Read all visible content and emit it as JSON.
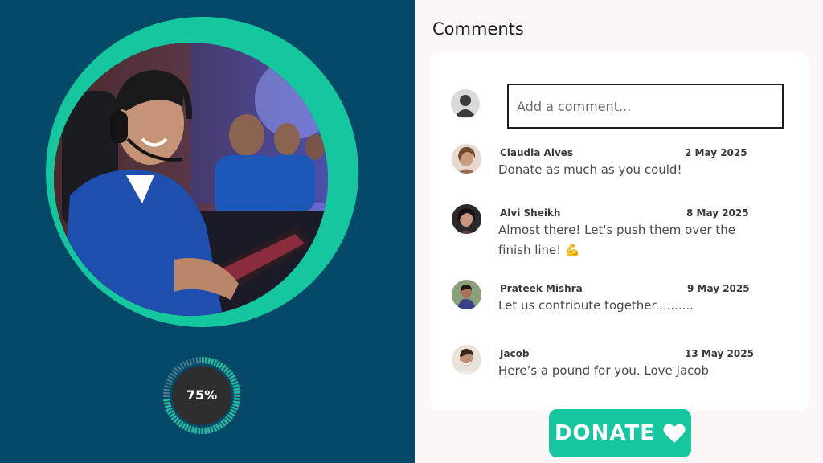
{
  "colors": {
    "left_bg": "#044a68",
    "accent": "#14c79e",
    "right_bg": "#fdf6f6",
    "progress_track": "#d9d9d9",
    "progress_center": "#2e2e2e"
  },
  "campaign": {
    "image_icon": "gamer-photo",
    "progress": {
      "percent": 75,
      "label": "75%"
    }
  },
  "comments_section": {
    "title": "Comments",
    "input": {
      "placeholder": "Add a comment...",
      "value": ""
    },
    "user_avatar_icon": "user-avatar-icon",
    "comments": [
      {
        "name": "Claudia Alves",
        "date": "2 May 2025",
        "text": "Donate as much as you could!"
      },
      {
        "name": "Alvi Sheikh",
        "date": "8 May 2025",
        "text": "Almost there! Let's push them over the finish line! 💪"
      },
      {
        "name": "Prateek Mishra",
        "date": "9 May 2025",
        "text": "Let us contribute together.........."
      },
      {
        "name": "Jacob",
        "date": "13 May 2025",
        "text": "Here’s a pound for you. Love Jacob"
      }
    ]
  },
  "donate": {
    "label": "DONATE",
    "icon": "heart-icon"
  }
}
